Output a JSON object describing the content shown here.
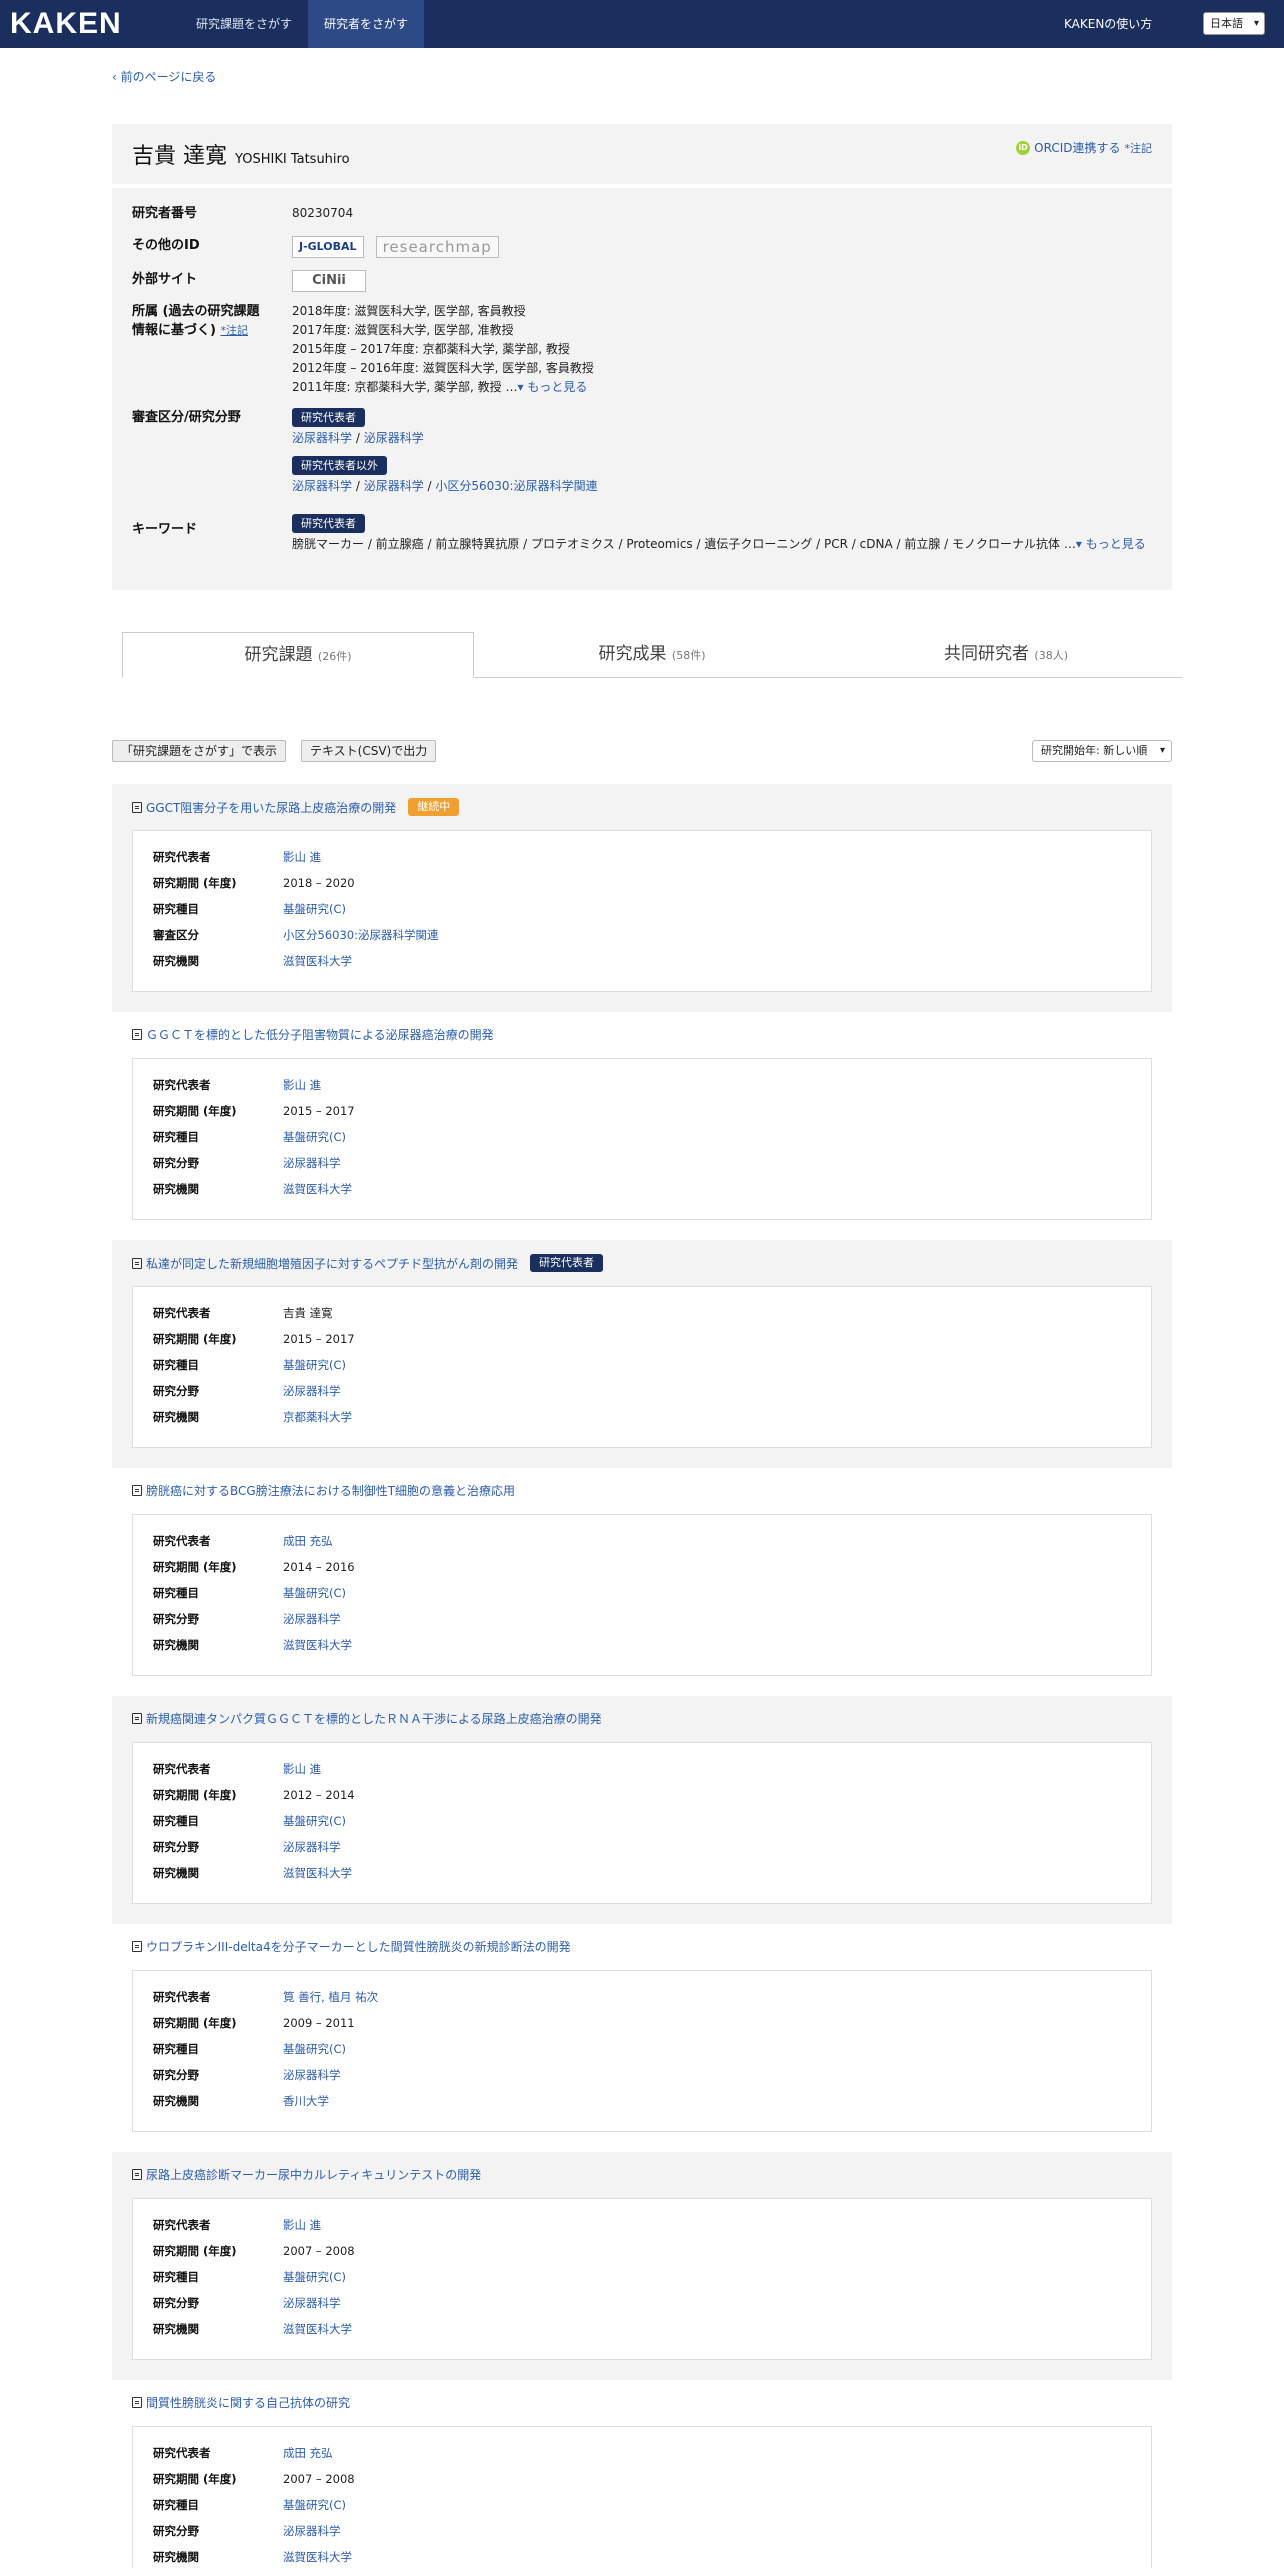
{
  "nav": {
    "logo": "KAKEN",
    "tabs": [
      "研究課題をさがす",
      "研究者をさがす"
    ],
    "help": "KAKENの使い方",
    "lang": "日本語"
  },
  "back_link": "前のページに戻る",
  "researcher": {
    "name_ja": "吉貴 達寛",
    "name_en": "YOSHIKI Tatsuhiro",
    "orcid_link": "ORCID連携する",
    "orcid_note": "*注記"
  },
  "profile": {
    "number_label": "研究者番号",
    "number": "80230704",
    "other_id_label": "その他のID",
    "jglobal": "J-GLOBAL",
    "researchmap": "researchmap",
    "external_label": "外部サイト",
    "cinii": "CiNii",
    "affil_label_1": "所属 (過去の研究課題",
    "affil_label_2": "情報に基づく)",
    "affil_note": "*注記",
    "affiliations": [
      "2018年度: 滋賀医科大学, 医学部, 客員教授",
      "2017年度: 滋賀医科大学, 医学部, 准教授",
      "2015年度 – 2017年度: 京都薬科大学, 薬学部, 教授",
      "2012年度 – 2016年度: 滋賀医科大学, 医学部, 客員教授",
      "2011年度: 京都薬科大学, 薬学部, 教授 …"
    ],
    "more": "もっと見る",
    "field_label": "審査区分/研究分野",
    "rep_badge": "研究代表者",
    "rep_fields": [
      "泌尿器科学",
      "泌尿器科学"
    ],
    "nonrep_badge": "研究代表者以外",
    "nonrep_fields": [
      "泌尿器科学",
      "泌尿器科学",
      "小区分56030:泌尿器科学関連"
    ],
    "keyword_label": "キーワード",
    "keyword_badge": "研究代表者",
    "keywords": "膀胱マーカー / 前立腺癌 / 前立腺特異抗原 / プロテオミクス / Proteomics / 遺伝子クローニング / PCR / cDNA / 前立腺 / モノクローナル抗体 …",
    "keywords_more": "もっと見る"
  },
  "tabs": [
    {
      "label": "研究課題",
      "count": "(26件)"
    },
    {
      "label": "研究成果",
      "count": "(58件)"
    },
    {
      "label": "共同研究者",
      "count": "(38人)"
    }
  ],
  "toolbar": {
    "show_btn": "「研究課題をさがす」で表示",
    "csv_btn": "テキスト(CSV)で出力",
    "sort": "研究開始年: 新しい順"
  },
  "projects": [
    {
      "title": "GGCT阻害分子を用いた尿路上皮癌治療の開発",
      "badge": "継続中",
      "rows": [
        {
          "label": "研究代表者",
          "value": "影山 進"
        },
        {
          "label": "研究期間 (年度)",
          "value": "2018 – 2020"
        },
        {
          "label": "研究種目",
          "value": "基盤研究(C)"
        },
        {
          "label": "審査区分",
          "value": "小区分56030:泌尿器科学関連"
        },
        {
          "label": "研究機関",
          "value": "滋賀医科大学"
        }
      ]
    },
    {
      "title": "ＧＧＣＴを標的とした低分子阻害物質による泌尿器癌治療の開発",
      "badge": "",
      "rows": [
        {
          "label": "研究代表者",
          "value": "影山 進"
        },
        {
          "label": "研究期間 (年度)",
          "value": "2015 – 2017"
        },
        {
          "label": "研究種目",
          "value": "基盤研究(C)"
        },
        {
          "label": "研究分野",
          "value": "泌尿器科学"
        },
        {
          "label": "研究機関",
          "value": "滋賀医科大学"
        }
      ]
    },
    {
      "title": "私達が同定した新規細胞増殖因子に対するペプチド型抗がん剤の開発",
      "badge": "研究代表者",
      "rows": [
        {
          "label": "研究代表者",
          "value": "吉貴 達寛"
        },
        {
          "label": "研究期間 (年度)",
          "value": "2015 – 2017"
        },
        {
          "label": "研究種目",
          "value": "基盤研究(C)"
        },
        {
          "label": "研究分野",
          "value": "泌尿器科学"
        },
        {
          "label": "研究機関",
          "value": "京都薬科大学"
        }
      ]
    },
    {
      "title": "膀胱癌に対するBCG膀注療法における制御性T細胞の意義と治療応用",
      "badge": "",
      "rows": [
        {
          "label": "研究代表者",
          "value": "成田 充弘"
        },
        {
          "label": "研究期間 (年度)",
          "value": "2014 – 2016"
        },
        {
          "label": "研究種目",
          "value": "基盤研究(C)"
        },
        {
          "label": "研究分野",
          "value": "泌尿器科学"
        },
        {
          "label": "研究機関",
          "value": "滋賀医科大学"
        }
      ]
    },
    {
      "title": "新規癌関連タンパク質ＧＧＣＴを標的としたＲＮＡ干渉による尿路上皮癌治療の開発",
      "badge": "",
      "rows": [
        {
          "label": "研究代表者",
          "value": "影山 進"
        },
        {
          "label": "研究期間 (年度)",
          "value": "2012 – 2014"
        },
        {
          "label": "研究種目",
          "value": "基盤研究(C)"
        },
        {
          "label": "研究分野",
          "value": "泌尿器科学"
        },
        {
          "label": "研究機関",
          "value": "滋賀医科大学"
        }
      ]
    },
    {
      "title": "ウロプラキンIII-delta4を分子マーカーとした間質性膀胱炎の新規診断法の開発",
      "badge": "",
      "rows": [
        {
          "label": "研究代表者",
          "value": "筧 善行, 植月 祐次"
        },
        {
          "label": "研究期間 (年度)",
          "value": "2009 – 2011"
        },
        {
          "label": "研究種目",
          "value": "基盤研究(C)"
        },
        {
          "label": "研究分野",
          "value": "泌尿器科学"
        },
        {
          "label": "研究機関",
          "value": "香川大学"
        }
      ]
    },
    {
      "title": "尿路上皮癌診断マーカー尿中カルレティキュリンテストの開発",
      "badge": "",
      "rows": [
        {
          "label": "研究代表者",
          "value": "影山 進"
        },
        {
          "label": "研究期間 (年度)",
          "value": "2007 – 2008"
        },
        {
          "label": "研究種目",
          "value": "基盤研究(C)"
        },
        {
          "label": "研究分野",
          "value": "泌尿器科学"
        },
        {
          "label": "研究機関",
          "value": "滋賀医科大学"
        }
      ]
    },
    {
      "title": "間質性膀胱炎に関する自己抗体の研究",
      "badge": "",
      "rows": [
        {
          "label": "研究代表者",
          "value": "成田 充弘"
        },
        {
          "label": "研究期間 (年度)",
          "value": "2007 – 2008"
        },
        {
          "label": "研究種目",
          "value": "基盤研究(C)"
        },
        {
          "label": "研究分野",
          "value": "泌尿器科学"
        },
        {
          "label": "研究機関",
          "value": "滋賀医科大学"
        }
      ]
    }
  ]
}
